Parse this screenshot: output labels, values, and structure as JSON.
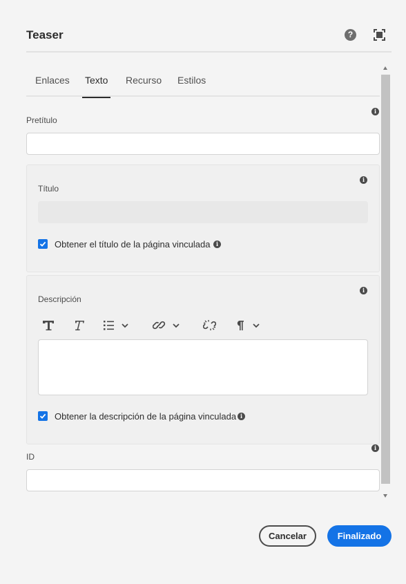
{
  "dialog": {
    "title": "Teaser",
    "help_icon": "help-icon",
    "fullscreen_icon": "fullscreen-icon"
  },
  "tabs": [
    {
      "label": "Enlaces",
      "active": false
    },
    {
      "label": "Texto",
      "active": true
    },
    {
      "label": "Recurso",
      "active": false
    },
    {
      "label": "Estilos",
      "active": false
    }
  ],
  "fields": {
    "pretitle": {
      "label": "Pretítulo",
      "value": ""
    },
    "title": {
      "label": "Título",
      "value": "",
      "disabled": true
    },
    "title_from_page": {
      "label": "Obtener el título de la página vinculada",
      "checked": true
    },
    "description": {
      "label": "Descripción",
      "value": ""
    },
    "description_from_page": {
      "label": "Obtener la descripción de la página vinculada",
      "checked": true
    },
    "id": {
      "label": "ID",
      "value": ""
    }
  },
  "rte_toolbar": [
    "bold-icon",
    "italic-icon",
    "list-icon",
    "link-icon",
    "unlink-icon",
    "paragraph-icon"
  ],
  "info_glyph": "i",
  "footer": {
    "cancel_label": "Cancelar",
    "done_label": "Finalizado"
  },
  "colors": {
    "accent": "#1473e6",
    "background": "#f4f4f4",
    "panel": "#f0f0f0"
  }
}
